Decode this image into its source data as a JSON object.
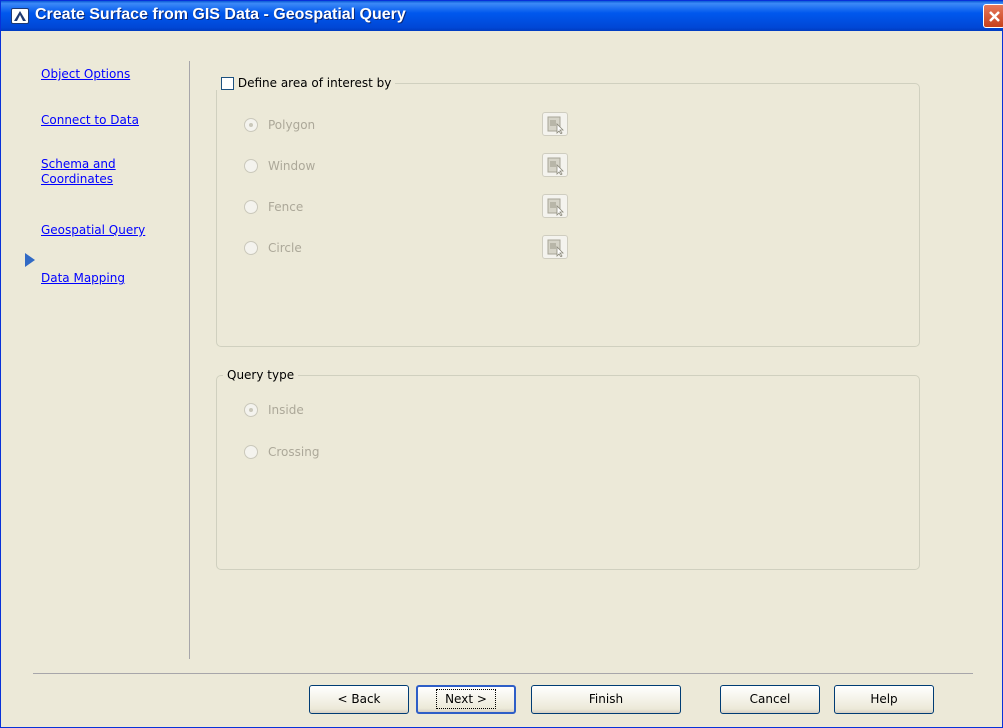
{
  "window": {
    "title": "Create Surface from GIS Data - Geospatial Query"
  },
  "nav": {
    "items": [
      {
        "label": "Object Options"
      },
      {
        "label": "Connect to Data"
      },
      {
        "label": "Schema and Coordinates"
      },
      {
        "label": "Geospatial Query",
        "current": true
      },
      {
        "label": "Data Mapping"
      }
    ]
  },
  "area_of_interest": {
    "checkbox_label": "Define area of interest by",
    "checked": false,
    "options": [
      {
        "label": "Polygon",
        "selected": true,
        "enabled": false
      },
      {
        "label": "Window",
        "selected": false,
        "enabled": false
      },
      {
        "label": "Fence",
        "selected": false,
        "enabled": false
      },
      {
        "label": "Circle",
        "selected": false,
        "enabled": false
      }
    ]
  },
  "query_type": {
    "legend": "Query type",
    "options": [
      {
        "label": "Inside",
        "selected": true,
        "enabled": false
      },
      {
        "label": "Crossing",
        "selected": false,
        "enabled": false
      }
    ]
  },
  "buttons": {
    "back": "< Back",
    "next": "Next >",
    "finish": "Finish",
    "cancel": "Cancel",
    "help": "Help"
  },
  "colors": {
    "dialog_bg": "#ece9d8",
    "titlebar": "#0058ee",
    "link": "#0000ff",
    "disabled_text": "#aca899"
  }
}
